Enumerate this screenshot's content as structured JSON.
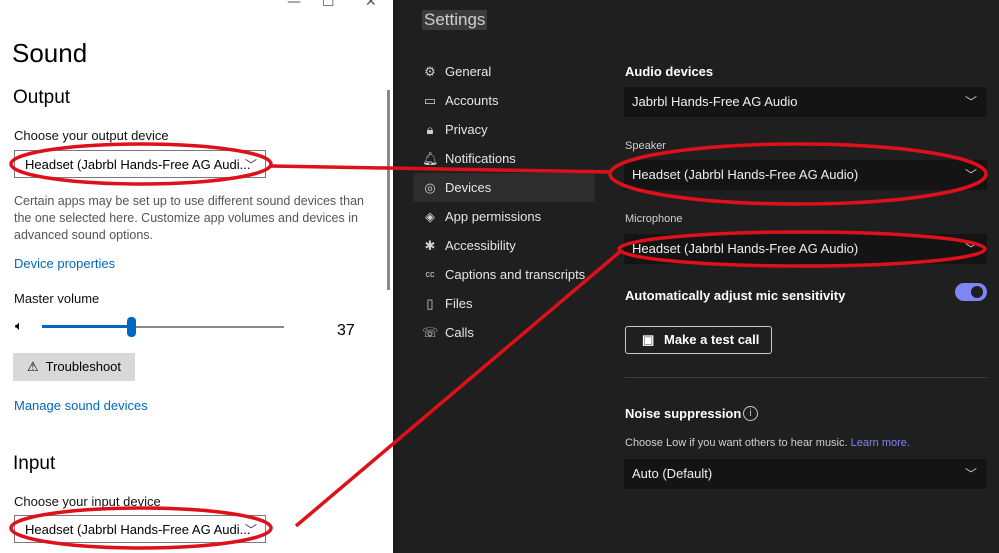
{
  "left": {
    "window_controls": {
      "minimize": "—",
      "maximize": "☐",
      "close": "✕"
    },
    "title": "Sound",
    "output": {
      "heading": "Output",
      "choose_label": "Choose your output device",
      "device_value": "Headset (Jabrbl Hands-Free AG Audi...",
      "description": "Certain apps may be set up to use different sound devices than the one selected here. Customize app volumes and devices in advanced sound options.",
      "device_properties_link": "Device properties",
      "master_volume_label": "Master volume",
      "volume_value": "37",
      "volume_level": 0.37,
      "troubleshoot_label": "Troubleshoot",
      "manage_link": "Manage sound devices"
    },
    "input": {
      "heading": "Input",
      "choose_label": "Choose your input device",
      "device_value": "Headset (Jabrbl Hands-Free AG Audi..."
    }
  },
  "right": {
    "title": "Settings",
    "nav": [
      {
        "label": "General",
        "icon": "gear-icon",
        "glyph": "⚙"
      },
      {
        "label": "Accounts",
        "icon": "id-card-icon",
        "glyph": "▭"
      },
      {
        "label": "Privacy",
        "icon": "lock-icon",
        "glyph": "🔒︎"
      },
      {
        "label": "Notifications",
        "icon": "bell-icon",
        "glyph": "🔔︎"
      },
      {
        "label": "Devices",
        "icon": "headset-icon",
        "glyph": "◎"
      },
      {
        "label": "App permissions",
        "icon": "shield-icon",
        "glyph": "◈"
      },
      {
        "label": "Accessibility",
        "icon": "accessibility-icon",
        "glyph": "✱"
      },
      {
        "label": "Captions and transcripts",
        "icon": "captions-icon",
        "glyph": "cc"
      },
      {
        "label": "Files",
        "icon": "file-icon",
        "glyph": "▯"
      },
      {
        "label": "Calls",
        "icon": "phone-icon",
        "glyph": "☏"
      }
    ],
    "active_nav": "Devices",
    "audio_devices_label": "Audio devices",
    "audio_devices_value": "Jabrbl Hands-Free AG Audio",
    "speaker_label": "Speaker",
    "speaker_value": "Headset (Jabrbl Hands-Free AG Audio)",
    "microphone_label": "Microphone",
    "microphone_value": "Headset (Jabrbl Hands-Free AG Audio)",
    "auto_adjust_label": "Automatically adjust mic sensitivity",
    "auto_adjust_on": true,
    "test_call_label": "Make a test call",
    "noise_label": "Noise suppression",
    "noise_hint": "Choose Low if you want others to hear music.",
    "learn_more": "Learn more.",
    "noise_value": "Auto (Default)"
  },
  "colors": {
    "accent_blue": "#0067c0",
    "teams_toggle": "#7f85f5",
    "annotation_red": "#e0101a",
    "teams_bg": "#1f1f1f"
  }
}
